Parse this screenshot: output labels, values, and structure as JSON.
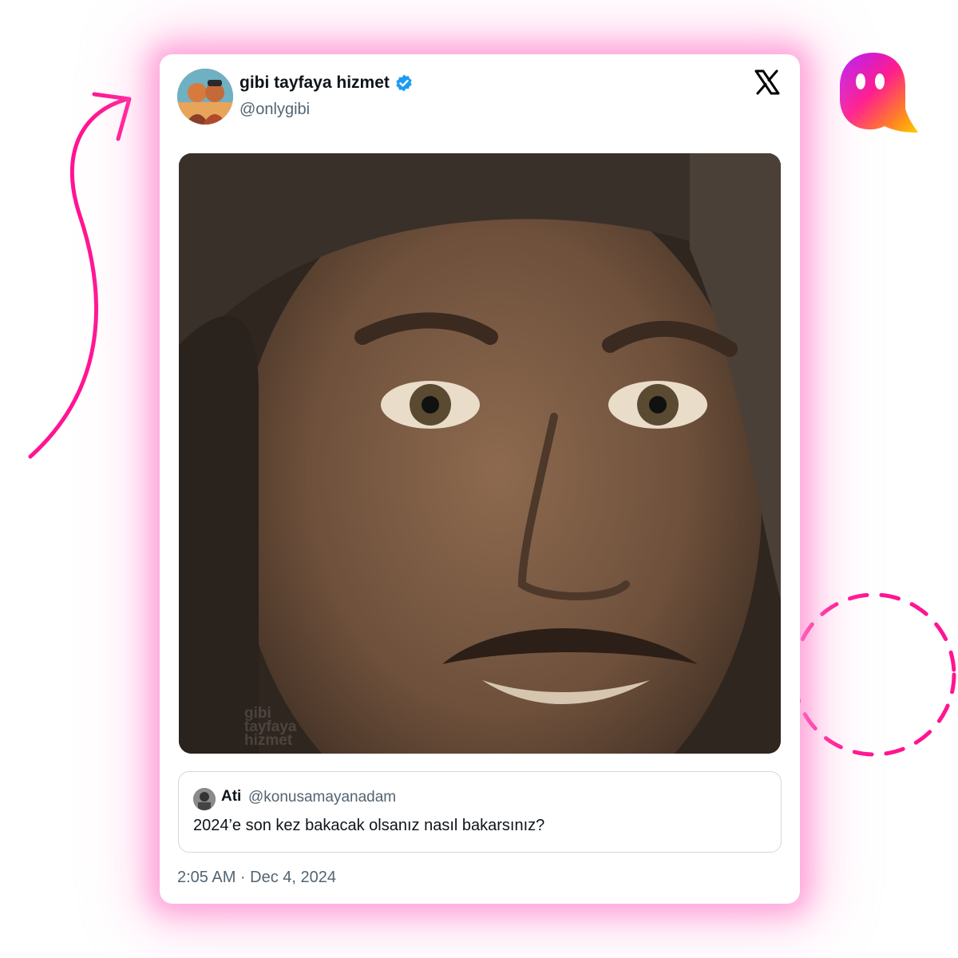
{
  "tweet": {
    "display_name": "gibi tayfaya hizmet",
    "handle": "@onlygibi",
    "verified_icon": "verified-badge-icon",
    "platform_icon": "x-logo-icon",
    "media": {
      "watermark": "gibi tayfaya hizmet"
    },
    "quoted": {
      "name": "Ati",
      "handle": "@konusamayanadam",
      "text": "2024’e son kez bakacak olsanız nasıl bakarsınız?"
    },
    "timestamp": "2:05 AM · Dec 4, 2024"
  },
  "colors": {
    "glow": "#ff7ac8",
    "accent_pink": "#ff1493",
    "verified_blue": "#1d9bf0"
  }
}
